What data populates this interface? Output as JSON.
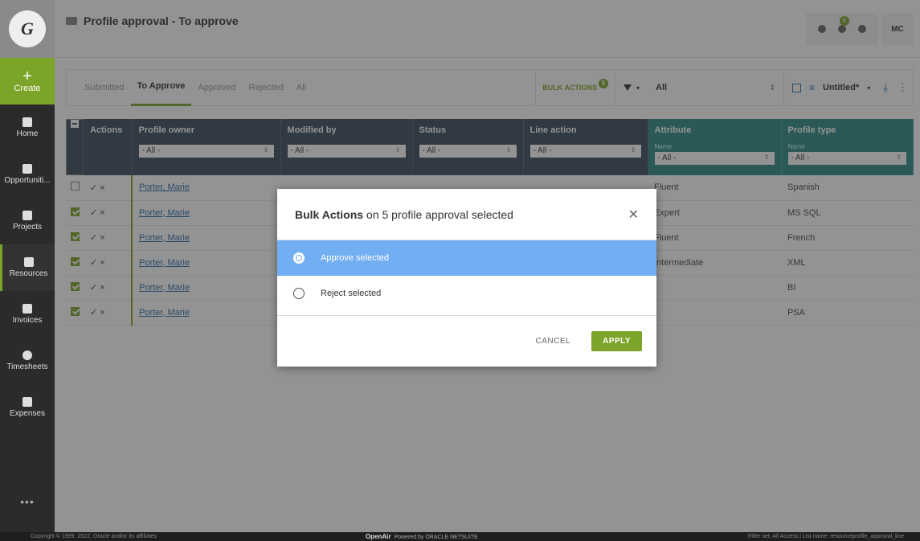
{
  "sidebar": {
    "logo": "G",
    "create": "Create",
    "items": [
      {
        "label": "Home",
        "icon": "home-icon"
      },
      {
        "label": "Opportuniti...",
        "icon": "chat-icon"
      },
      {
        "label": "Projects",
        "icon": "projects-icon"
      },
      {
        "label": "Resources",
        "icon": "resources-icon"
      },
      {
        "label": "Invoices",
        "icon": "invoice-icon"
      },
      {
        "label": "Timesheets",
        "icon": "clock-icon"
      },
      {
        "label": "Expenses",
        "icon": "card-icon"
      }
    ],
    "more": "•••"
  },
  "header": {
    "title": "Profile approval - To approve",
    "notification_count": "6",
    "user": "MC"
  },
  "tabs": [
    "Submitted",
    "To Approve",
    "Approved",
    "Rejected",
    "All"
  ],
  "active_tab": 1,
  "toolbar": {
    "bulk_actions": "BULK ACTIONS",
    "bulk_count": "5",
    "filter_value": "All",
    "view_name": "Untitled*"
  },
  "table": {
    "columns": {
      "actions": "Actions",
      "owner": "Profile owner",
      "modified": "Modified by",
      "status": "Status",
      "line_action": "Line action",
      "attribute": "Attribute",
      "profile_type": "Profile type"
    },
    "sub_name": "Name",
    "filter_all": "- All -",
    "rows": [
      {
        "checked": false,
        "owner": "Porter, Marie",
        "attribute": "Fluent",
        "profile_type": "Spanish"
      },
      {
        "checked": true,
        "owner": "Porter, Marie",
        "attribute": "Expert",
        "profile_type": "MS SQL"
      },
      {
        "checked": true,
        "owner": "Porter, Marie",
        "attribute": "Fluent",
        "profile_type": "French"
      },
      {
        "checked": true,
        "owner": "Porter, Marie",
        "attribute": "Intermediate",
        "profile_type": "XML"
      },
      {
        "checked": true,
        "owner": "Porter, Marie",
        "attribute": "",
        "profile_type": "BI"
      },
      {
        "checked": true,
        "owner": "Porter, Marie",
        "attribute": "",
        "profile_type": "PSA"
      }
    ],
    "action_glyphs": "✓ ×"
  },
  "modal": {
    "title_bold": "Bulk Actions",
    "title_rest": "on 5 profile approval selected",
    "options": [
      "Approve selected",
      "Reject selected"
    ],
    "selected": 0,
    "cancel": "CANCEL",
    "apply": "APPLY"
  },
  "footer": {
    "copyright": "Copyright © 1999, 2022, Oracle and/or its affiliates",
    "brand": "OpenAir",
    "powered": "Powered by ORACLE NETSUITE",
    "right": "Filter set: All Access | List name: resourceprofile_approval_line"
  },
  "colors": {
    "accent": "#7ba428",
    "header_dark": "#3b4a5e",
    "header_teal": "#2e8b87",
    "selection": "#72aef2"
  }
}
